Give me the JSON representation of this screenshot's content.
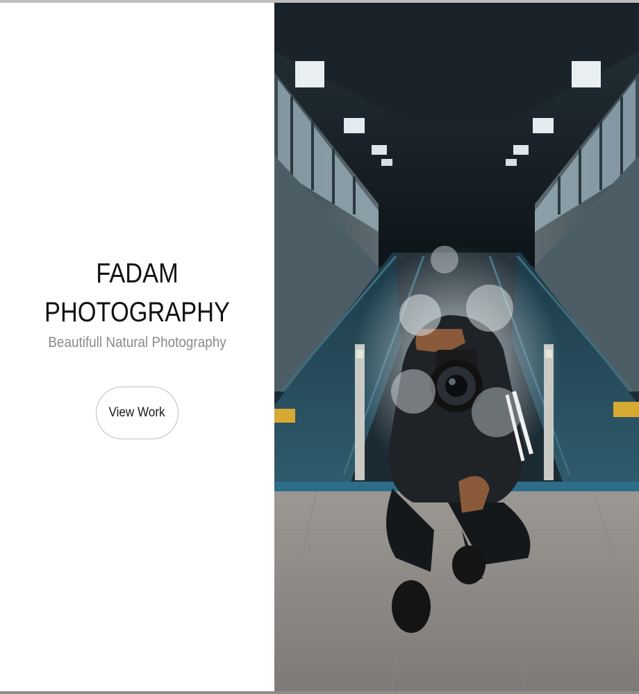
{
  "brand": {
    "title_line_1": "FADAM",
    "title_line_2": "PHOTOGRAPHY",
    "tagline": "Beautifull Natural Photography"
  },
  "actions": {
    "view_work_label": "View Work"
  },
  "hero": {
    "subject": "photographer crouching with camera in a subway station between escalators, smoke around"
  },
  "colors": {
    "background": "#ffffff",
    "title": "#111111",
    "tagline": "#8a8a8a",
    "button_border": "#bdbdbd"
  }
}
